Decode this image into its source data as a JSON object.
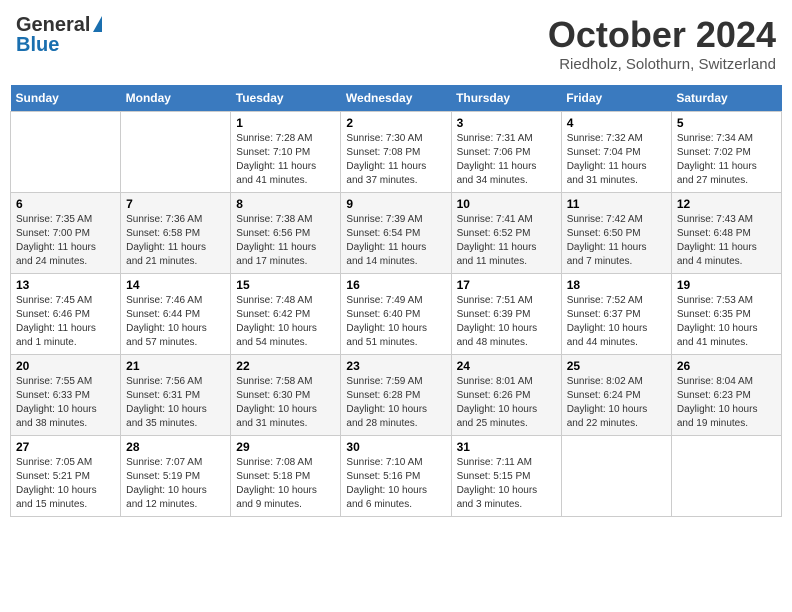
{
  "header": {
    "logo_general": "General",
    "logo_blue": "Blue",
    "month_title": "October 2024",
    "location": "Riedholz, Solothurn, Switzerland"
  },
  "days_of_week": [
    "Sunday",
    "Monday",
    "Tuesday",
    "Wednesday",
    "Thursday",
    "Friday",
    "Saturday"
  ],
  "weeks": [
    [
      {
        "day": "",
        "sunrise": "",
        "sunset": "",
        "daylight": ""
      },
      {
        "day": "",
        "sunrise": "",
        "sunset": "",
        "daylight": ""
      },
      {
        "day": "1",
        "sunrise": "Sunrise: 7:28 AM",
        "sunset": "Sunset: 7:10 PM",
        "daylight": "Daylight: 11 hours and 41 minutes."
      },
      {
        "day": "2",
        "sunrise": "Sunrise: 7:30 AM",
        "sunset": "Sunset: 7:08 PM",
        "daylight": "Daylight: 11 hours and 37 minutes."
      },
      {
        "day": "3",
        "sunrise": "Sunrise: 7:31 AM",
        "sunset": "Sunset: 7:06 PM",
        "daylight": "Daylight: 11 hours and 34 minutes."
      },
      {
        "day": "4",
        "sunrise": "Sunrise: 7:32 AM",
        "sunset": "Sunset: 7:04 PM",
        "daylight": "Daylight: 11 hours and 31 minutes."
      },
      {
        "day": "5",
        "sunrise": "Sunrise: 7:34 AM",
        "sunset": "Sunset: 7:02 PM",
        "daylight": "Daylight: 11 hours and 27 minutes."
      }
    ],
    [
      {
        "day": "6",
        "sunrise": "Sunrise: 7:35 AM",
        "sunset": "Sunset: 7:00 PM",
        "daylight": "Daylight: 11 hours and 24 minutes."
      },
      {
        "day": "7",
        "sunrise": "Sunrise: 7:36 AM",
        "sunset": "Sunset: 6:58 PM",
        "daylight": "Daylight: 11 hours and 21 minutes."
      },
      {
        "day": "8",
        "sunrise": "Sunrise: 7:38 AM",
        "sunset": "Sunset: 6:56 PM",
        "daylight": "Daylight: 11 hours and 17 minutes."
      },
      {
        "day": "9",
        "sunrise": "Sunrise: 7:39 AM",
        "sunset": "Sunset: 6:54 PM",
        "daylight": "Daylight: 11 hours and 14 minutes."
      },
      {
        "day": "10",
        "sunrise": "Sunrise: 7:41 AM",
        "sunset": "Sunset: 6:52 PM",
        "daylight": "Daylight: 11 hours and 11 minutes."
      },
      {
        "day": "11",
        "sunrise": "Sunrise: 7:42 AM",
        "sunset": "Sunset: 6:50 PM",
        "daylight": "Daylight: 11 hours and 7 minutes."
      },
      {
        "day": "12",
        "sunrise": "Sunrise: 7:43 AM",
        "sunset": "Sunset: 6:48 PM",
        "daylight": "Daylight: 11 hours and 4 minutes."
      }
    ],
    [
      {
        "day": "13",
        "sunrise": "Sunrise: 7:45 AM",
        "sunset": "Sunset: 6:46 PM",
        "daylight": "Daylight: 11 hours and 1 minute."
      },
      {
        "day": "14",
        "sunrise": "Sunrise: 7:46 AM",
        "sunset": "Sunset: 6:44 PM",
        "daylight": "Daylight: 10 hours and 57 minutes."
      },
      {
        "day": "15",
        "sunrise": "Sunrise: 7:48 AM",
        "sunset": "Sunset: 6:42 PM",
        "daylight": "Daylight: 10 hours and 54 minutes."
      },
      {
        "day": "16",
        "sunrise": "Sunrise: 7:49 AM",
        "sunset": "Sunset: 6:40 PM",
        "daylight": "Daylight: 10 hours and 51 minutes."
      },
      {
        "day": "17",
        "sunrise": "Sunrise: 7:51 AM",
        "sunset": "Sunset: 6:39 PM",
        "daylight": "Daylight: 10 hours and 48 minutes."
      },
      {
        "day": "18",
        "sunrise": "Sunrise: 7:52 AM",
        "sunset": "Sunset: 6:37 PM",
        "daylight": "Daylight: 10 hours and 44 minutes."
      },
      {
        "day": "19",
        "sunrise": "Sunrise: 7:53 AM",
        "sunset": "Sunset: 6:35 PM",
        "daylight": "Daylight: 10 hours and 41 minutes."
      }
    ],
    [
      {
        "day": "20",
        "sunrise": "Sunrise: 7:55 AM",
        "sunset": "Sunset: 6:33 PM",
        "daylight": "Daylight: 10 hours and 38 minutes."
      },
      {
        "day": "21",
        "sunrise": "Sunrise: 7:56 AM",
        "sunset": "Sunset: 6:31 PM",
        "daylight": "Daylight: 10 hours and 35 minutes."
      },
      {
        "day": "22",
        "sunrise": "Sunrise: 7:58 AM",
        "sunset": "Sunset: 6:30 PM",
        "daylight": "Daylight: 10 hours and 31 minutes."
      },
      {
        "day": "23",
        "sunrise": "Sunrise: 7:59 AM",
        "sunset": "Sunset: 6:28 PM",
        "daylight": "Daylight: 10 hours and 28 minutes."
      },
      {
        "day": "24",
        "sunrise": "Sunrise: 8:01 AM",
        "sunset": "Sunset: 6:26 PM",
        "daylight": "Daylight: 10 hours and 25 minutes."
      },
      {
        "day": "25",
        "sunrise": "Sunrise: 8:02 AM",
        "sunset": "Sunset: 6:24 PM",
        "daylight": "Daylight: 10 hours and 22 minutes."
      },
      {
        "day": "26",
        "sunrise": "Sunrise: 8:04 AM",
        "sunset": "Sunset: 6:23 PM",
        "daylight": "Daylight: 10 hours and 19 minutes."
      }
    ],
    [
      {
        "day": "27",
        "sunrise": "Sunrise: 7:05 AM",
        "sunset": "Sunset: 5:21 PM",
        "daylight": "Daylight: 10 hours and 15 minutes."
      },
      {
        "day": "28",
        "sunrise": "Sunrise: 7:07 AM",
        "sunset": "Sunset: 5:19 PM",
        "daylight": "Daylight: 10 hours and 12 minutes."
      },
      {
        "day": "29",
        "sunrise": "Sunrise: 7:08 AM",
        "sunset": "Sunset: 5:18 PM",
        "daylight": "Daylight: 10 hours and 9 minutes."
      },
      {
        "day": "30",
        "sunrise": "Sunrise: 7:10 AM",
        "sunset": "Sunset: 5:16 PM",
        "daylight": "Daylight: 10 hours and 6 minutes."
      },
      {
        "day": "31",
        "sunrise": "Sunrise: 7:11 AM",
        "sunset": "Sunset: 5:15 PM",
        "daylight": "Daylight: 10 hours and 3 minutes."
      },
      {
        "day": "",
        "sunrise": "",
        "sunset": "",
        "daylight": ""
      },
      {
        "day": "",
        "sunrise": "",
        "sunset": "",
        "daylight": ""
      }
    ]
  ]
}
